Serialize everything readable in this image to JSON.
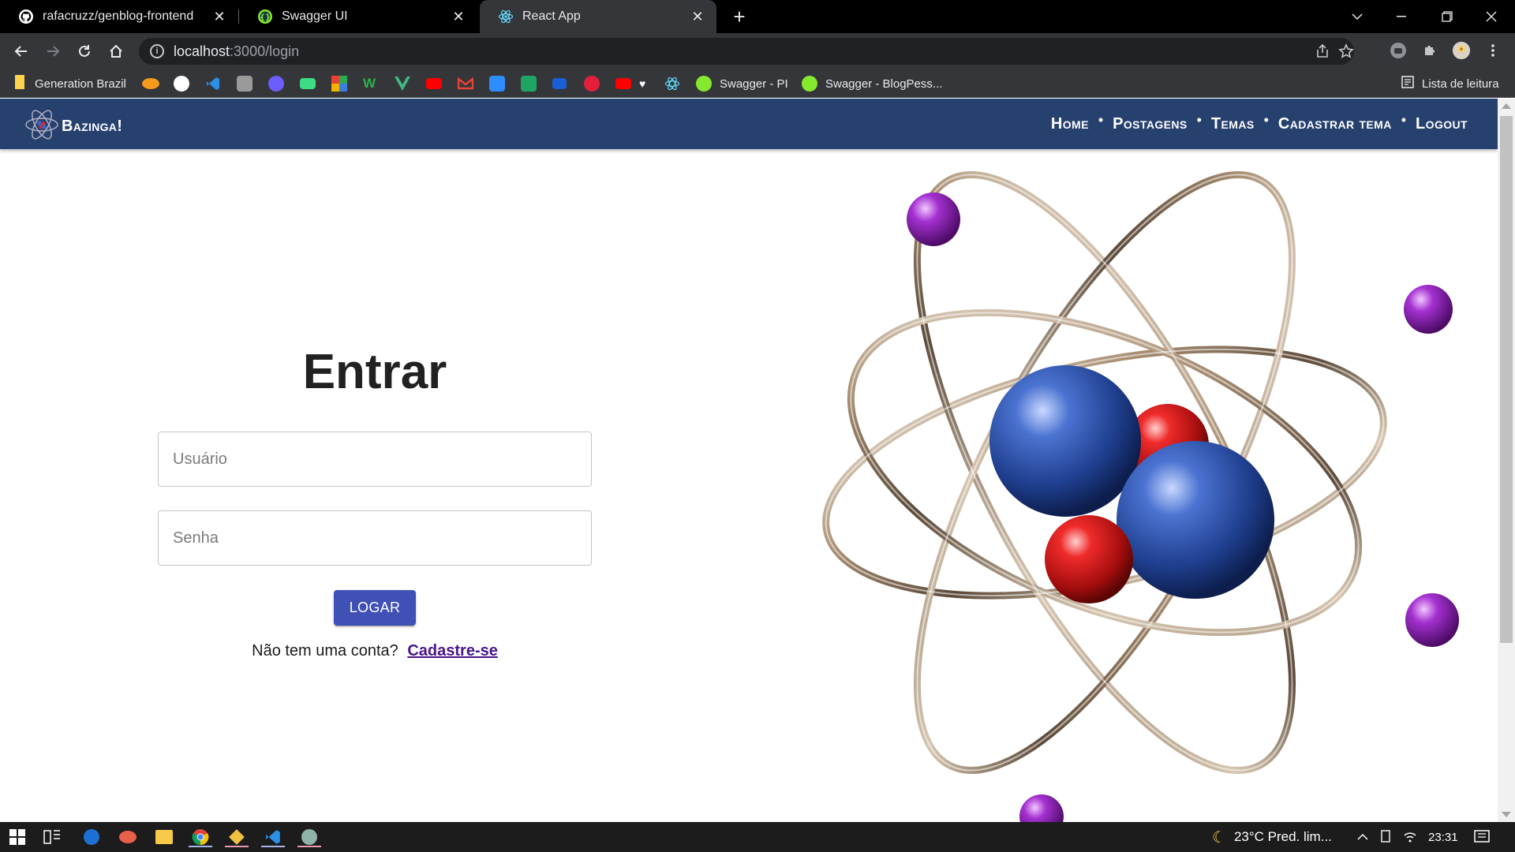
{
  "browser": {
    "tabs": [
      {
        "title": "rafacruzz/genblog-frontend",
        "icon": "github-icon",
        "active": false
      },
      {
        "title": "Swagger UI",
        "icon": "swagger-icon",
        "active": false
      },
      {
        "title": "React App",
        "icon": "react-icon",
        "active": true
      }
    ],
    "url_host": "localhost",
    "url_path": ":3000/login",
    "reading_list_label": "Lista de leitura",
    "bookmarks": [
      {
        "label": "Generation Brazil",
        "icon": "folder-icon"
      },
      {
        "label": "Swagger - PI",
        "icon": "swagger-icon"
      },
      {
        "label": "Swagger - BlogPess...",
        "icon": "swagger-icon"
      }
    ]
  },
  "appbar": {
    "brand": "Bazinga!",
    "menu": [
      "Home",
      "Postagens",
      "Temas",
      "Cadastrar tema",
      "Logout"
    ]
  },
  "login": {
    "title": "Entrar",
    "username_placeholder": "Usuário",
    "password_placeholder": "Senha",
    "submit_label": "LOGAR",
    "signup_prompt": "Não tem uma conta?",
    "signup_link": "Cadastre-se"
  },
  "taskbar": {
    "weather": "23°C  Pred. lim...",
    "clock": "23:31"
  },
  "colors": {
    "appbar": "#27416f",
    "button": "#3f51b5",
    "link": "#4a148c"
  }
}
